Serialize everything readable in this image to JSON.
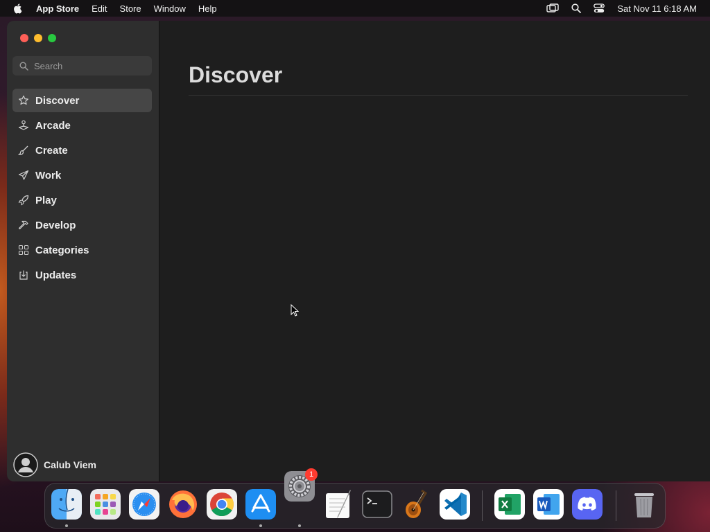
{
  "menubar": {
    "app_name": "App Store",
    "menus": [
      "Edit",
      "Store",
      "Window",
      "Help"
    ],
    "clock": "Sat Nov 11  6:18 AM"
  },
  "sidebar": {
    "search_placeholder": "Search",
    "items": [
      {
        "label": "Discover",
        "icon": "star-icon",
        "active": true
      },
      {
        "label": "Arcade",
        "icon": "joystick-icon",
        "active": false
      },
      {
        "label": "Create",
        "icon": "brush-icon",
        "active": false
      },
      {
        "label": "Work",
        "icon": "paper-plane-icon",
        "active": false
      },
      {
        "label": "Play",
        "icon": "rocket-icon",
        "active": false
      },
      {
        "label": "Develop",
        "icon": "hammer-icon",
        "active": false
      },
      {
        "label": "Categories",
        "icon": "grid-icon",
        "active": false
      },
      {
        "label": "Updates",
        "icon": "download-icon",
        "active": false
      }
    ],
    "user_name": "Calub Viem"
  },
  "main": {
    "title": "Discover"
  },
  "dock": {
    "apps": [
      "finder",
      "launchpad",
      "safari",
      "firefox",
      "chrome",
      "app-store",
      "system-settings",
      "textedit",
      "terminal",
      "garageband",
      "vscode",
      "excel",
      "word",
      "discord",
      "trash"
    ],
    "settings_badge": "1"
  },
  "colors": {
    "accent_active_bg": "#464646",
    "sidebar_bg": "#2e2e2e",
    "main_bg": "#1e1e1e"
  }
}
